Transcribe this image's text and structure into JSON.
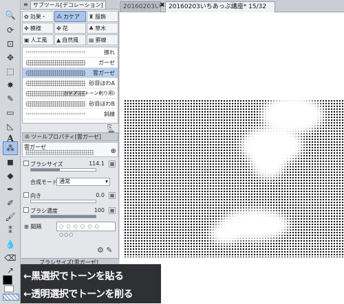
{
  "subtool_tab": {
    "title": "サブツール[デコレーション]"
  },
  "groups": [
    {
      "icon": "flower-icon",
      "label": "効果・",
      "active": false
    },
    {
      "icon": "tone-icon",
      "label": "カケア",
      "active": true
    },
    {
      "icon": "clothing-icon",
      "label": "服飾",
      "active": false
    },
    {
      "icon": "pattern-icon",
      "label": "模様",
      "active": false
    },
    {
      "icon": "flower-icon",
      "label": "花",
      "active": false
    },
    {
      "icon": "grass-icon",
      "label": "草木",
      "active": false
    },
    {
      "icon": "building-icon",
      "label": "人工風",
      "active": false
    },
    {
      "icon": "nature-icon",
      "label": "自然風",
      "active": false
    },
    {
      "icon": "ruled-line-icon",
      "label": "罫線",
      "active": false
    }
  ],
  "brushes": [
    {
      "label": "擦れ",
      "selected": false,
      "thin": true
    },
    {
      "label": "ガーゼ",
      "selected": false,
      "thin": false
    },
    {
      "label": "雲ガーゼ",
      "selected": true,
      "thin": false
    },
    {
      "label": "砂目ほわA",
      "selected": false,
      "thin": false
    },
    {
      "label": "カケアミ(トーン削り用)",
      "selected": false,
      "thin": false
    },
    {
      "label": "砂目ほわB",
      "selected": false,
      "thin": false
    },
    {
      "label": "斜線",
      "selected": false,
      "thin": true
    }
  ],
  "property": {
    "header": "ツールプロパティ[雲ガーゼ]",
    "brush_name": "雲ガーゼ",
    "rows": [
      {
        "label": "ブラシサイズ",
        "value": "114.1",
        "fill": 0.45,
        "type": "slider"
      },
      {
        "label": "合成モード",
        "value": "通常",
        "type": "select"
      },
      {
        "label": "向き",
        "value": "0.0",
        "fill": 0.0,
        "type": "slider"
      },
      {
        "label": "ブラシ濃度",
        "value": "100",
        "fill": 1.0,
        "type": "slider"
      }
    ],
    "interval_label": "間隔",
    "interval_value": "○ ○ ○ ○ ○ ○ ○○○"
  },
  "size_panel": {
    "title": "ブラシサイズ[雲ガーゼ]"
  },
  "document_tabs": [
    {
      "label": "20160203い",
      "active": false
    },
    {
      "label": "20160203いちあっぷ講座* 15/32",
      "active": true
    }
  ],
  "annotation": {
    "line1": "←黒選択でトーンを貼る",
    "line2": "←透明選択でトーンを削る"
  },
  "colors": {
    "accent": "#a9c6ea",
    "panel": "#e4e6ea",
    "overlay": "#2f3033"
  }
}
